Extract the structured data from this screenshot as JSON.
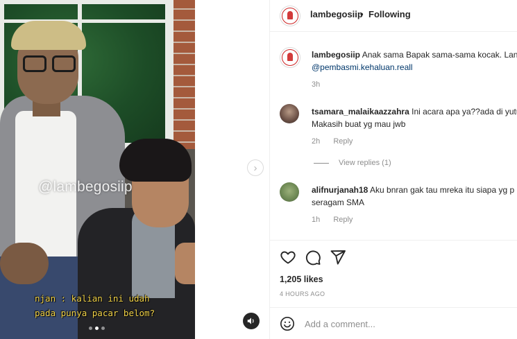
{
  "media": {
    "watermark": "@lambegosiip",
    "subtitle_line1": "njan : kalian ini udah",
    "subtitle_line2": "pada punya pacar belom?",
    "slide_count": 3,
    "active_slide": 2
  },
  "header": {
    "username": "lambegosiip",
    "separator": "•",
    "follow_status": "Following"
  },
  "comments": [
    {
      "username": "lambegosiip",
      "text": "Anak sama Bapak sama-sama kocak. Lanj",
      "text_line2": "@pembasmi.kehaluan.reall",
      "time": "3h",
      "reply_label": ""
    },
    {
      "username": "tsamara_malaikaazzahra",
      "text": "Ini acara apa ya??ada di yutub",
      "text_line2": "Makasih buat yg mau jwb",
      "time": "2h",
      "reply_label": "Reply"
    },
    {
      "username": "alifnurjanah18",
      "text": "Aku bnran gak tau mreka itu siapa yg p",
      "text_line2": "seragam SMA",
      "time": "1h",
      "reply_label": "Reply"
    }
  ],
  "view_replies": "View replies (1)",
  "actions": {
    "likes": "1,205 likes",
    "time_ago": "4 HOURS AGO"
  },
  "add_comment": {
    "placeholder": "Add a comment..."
  },
  "colors": {
    "mention": "#00376b",
    "muted": "#8e8e8e",
    "subtitle": "#f3d44a"
  }
}
